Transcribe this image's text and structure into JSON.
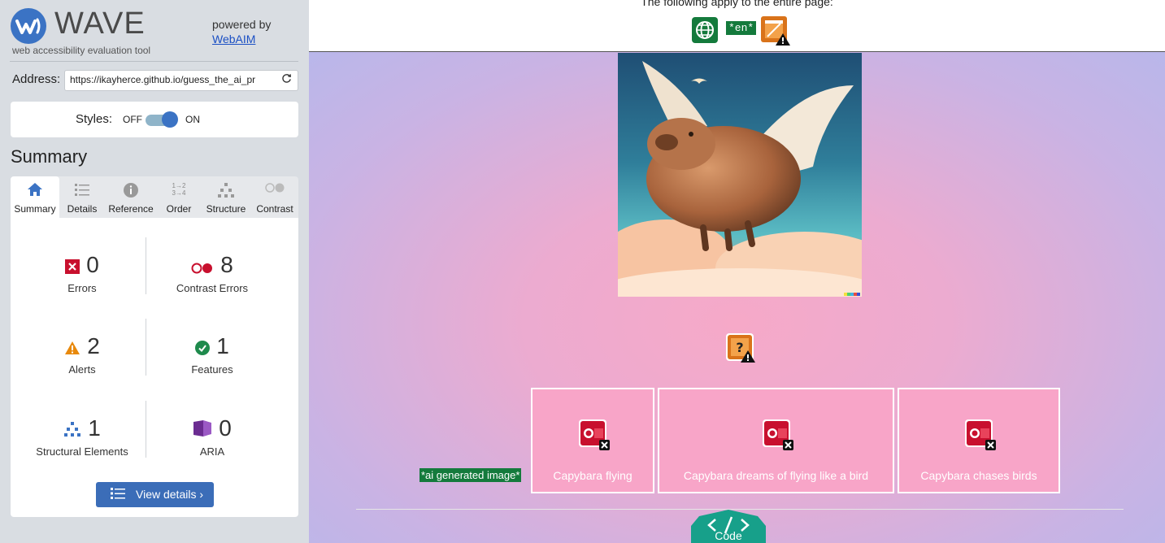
{
  "sidebar": {
    "logo_text": "WAVE",
    "tagline": "web accessibility evaluation tool",
    "powered_by": "powered by",
    "webaim_link": "WebAIM",
    "address_label": "Address:",
    "address_value": "https://ikayherce.github.io/guess_the_ai_pr",
    "styles_label": "Styles:",
    "styles_off": "OFF",
    "styles_on": "ON",
    "styles_enabled": true,
    "summary_heading": "Summary",
    "tabs": [
      {
        "label": "Summary",
        "icon": "home-icon",
        "active": true
      },
      {
        "label": "Details",
        "icon": "list-icon",
        "active": false
      },
      {
        "label": "Reference",
        "icon": "info-icon",
        "active": false
      },
      {
        "label": "Order",
        "icon": "order-icon",
        "active": false
      },
      {
        "label": "Structure",
        "icon": "structure-icon",
        "active": false
      },
      {
        "label": "Contrast",
        "icon": "contrast-icon",
        "active": false
      }
    ],
    "stats": {
      "errors": {
        "count": "0",
        "label": "Errors"
      },
      "contrast_errors": {
        "count": "8",
        "label": "Contrast Errors"
      },
      "alerts": {
        "count": "2",
        "label": "Alerts"
      },
      "features": {
        "count": "1",
        "label": "Features"
      },
      "structural": {
        "count": "1",
        "label": "Structural Elements"
      },
      "aria": {
        "count": "0",
        "label": "ARIA"
      }
    },
    "view_details": "View details ›"
  },
  "topbar": {
    "apply_text": "The following apply to the entire page:",
    "lang_badge": "*en*"
  },
  "main": {
    "ai_label": "*ai generated image*",
    "options": [
      {
        "text": "Capybara flying"
      },
      {
        "text": "Capybara dreams of flying like a bird"
      },
      {
        "text": "Capybara chases birds"
      }
    ],
    "code_button": "Code"
  },
  "colors": {
    "wave_blue": "#3b73c4",
    "error_red": "#c8102e",
    "alert_orange": "#e8890c",
    "feature_green": "#1e8a4c",
    "aria_purple": "#6b2c91",
    "option_pink": "#f8a5c8",
    "code_teal": "#17a08a"
  }
}
